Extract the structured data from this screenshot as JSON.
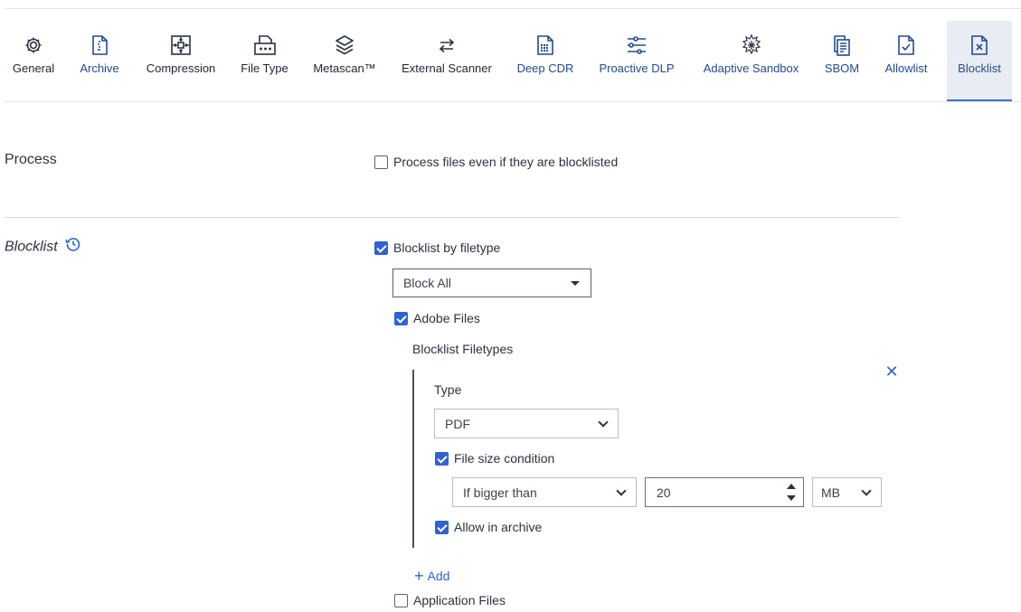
{
  "tabs": [
    {
      "label": "General",
      "icon": "gear-icon",
      "style": "plain"
    },
    {
      "label": "Archive",
      "icon": "archive-file-icon",
      "style": "blue"
    },
    {
      "label": "Compression",
      "icon": "compression-icon",
      "style": "plain"
    },
    {
      "label": "File Type",
      "icon": "file-type-icon",
      "style": "plain"
    },
    {
      "label": "Metascan™",
      "icon": "layers-icon",
      "style": "plain"
    },
    {
      "label": "External Scanner",
      "icon": "swap-arrows-icon",
      "style": "plain"
    },
    {
      "label": "Deep CDR",
      "icon": "deep-cdr-icon",
      "style": "blue"
    },
    {
      "label": "Proactive DLP",
      "icon": "dlp-icon",
      "style": "blue"
    },
    {
      "label": "Adaptive Sandbox",
      "icon": "sandbox-icon",
      "style": "blue"
    },
    {
      "label": "SBOM",
      "icon": "sbom-icon",
      "style": "blue"
    },
    {
      "label": "Allowlist",
      "icon": "allowlist-icon",
      "style": "blue"
    },
    {
      "label": "Blocklist",
      "icon": "blocklist-icon",
      "style": "active"
    }
  ],
  "process": {
    "title": "Process",
    "checkbox_label": "Process files even if they are blocklisted",
    "checked": false
  },
  "blocklist": {
    "title": "Blocklist",
    "history_icon": "history-icon",
    "by_filetype_label": "Blocklist by filetype",
    "by_filetype_checked": true,
    "mode_select": "Block All",
    "adobe": {
      "label": "Adobe Files",
      "checked": true,
      "filetypes_heading": "Blocklist Filetypes",
      "entry": {
        "type_label": "Type",
        "type_value": "PDF",
        "size_condition_label": "File size condition",
        "size_condition_checked": true,
        "condition_value": "If bigger than",
        "size_value": "20",
        "unit_value": "MB",
        "allow_archive_label": "Allow in archive",
        "allow_archive_checked": true
      },
      "add_label": "Add"
    },
    "application": {
      "label": "Application Files",
      "checked": false
    }
  },
  "colors": {
    "accent": "#2e63d1",
    "nav_blue": "#234c8d",
    "active_tab_bg": "#e9ecf3"
  }
}
